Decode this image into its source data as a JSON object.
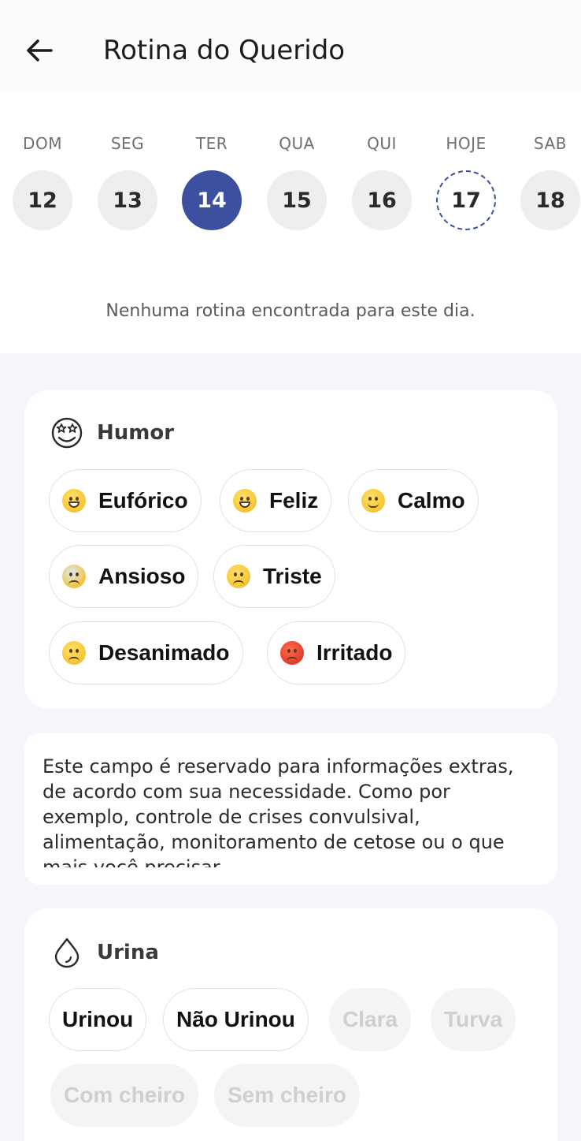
{
  "header": {
    "title": "Rotina do Querido",
    "back_icon": "arrow-left-icon"
  },
  "calendar": {
    "days": [
      {
        "name": "DOM",
        "number": "12",
        "state": "normal"
      },
      {
        "name": "SEG",
        "number": "13",
        "state": "normal"
      },
      {
        "name": "TER",
        "number": "14",
        "state": "selected"
      },
      {
        "name": "QUA",
        "number": "15",
        "state": "normal"
      },
      {
        "name": "QUI",
        "number": "16",
        "state": "normal"
      },
      {
        "name": "HOJE",
        "number": "17",
        "state": "today"
      },
      {
        "name": "SAB",
        "number": "18",
        "state": "normal"
      }
    ],
    "selected_color": "#3d4f9f"
  },
  "empty_message": "Nenhuma rotina encontrada para este dia.",
  "humor": {
    "title": "Humor",
    "icon": "star-eyes-face-icon",
    "options": [
      {
        "label": "Eufórico",
        "icon": "star-struck-emoji-icon"
      },
      {
        "label": "Feliz",
        "icon": "grinning-emoji-icon"
      },
      {
        "label": "Calmo",
        "icon": "slightly-smiling-emoji-icon"
      },
      {
        "label": "Ansioso",
        "icon": "anxious-sweat-emoji-icon"
      },
      {
        "label": "Triste",
        "icon": "frowning-emoji-icon"
      },
      {
        "label": "Desanimado",
        "icon": "sleepy-emoji-icon"
      },
      {
        "label": "Irritado",
        "icon": "angry-emoji-icon"
      }
    ]
  },
  "notes": {
    "text": "Este campo é reservado para informações extras, de acordo com sua necessidade. Como por exemplo, controle de crises convulsival, alimentação, monitoramento de cetose ou o que mais você precisar"
  },
  "urina": {
    "title": "Urina",
    "icon": "drop-icon",
    "options": [
      {
        "label": "Urinou",
        "enabled": true
      },
      {
        "label": "Não Urinou",
        "enabled": true
      },
      {
        "label": "Clara",
        "enabled": false
      },
      {
        "label": "Turva",
        "enabled": false
      },
      {
        "label": "Com cheiro",
        "enabled": false
      },
      {
        "label": "Sem cheiro",
        "enabled": false
      }
    ]
  }
}
